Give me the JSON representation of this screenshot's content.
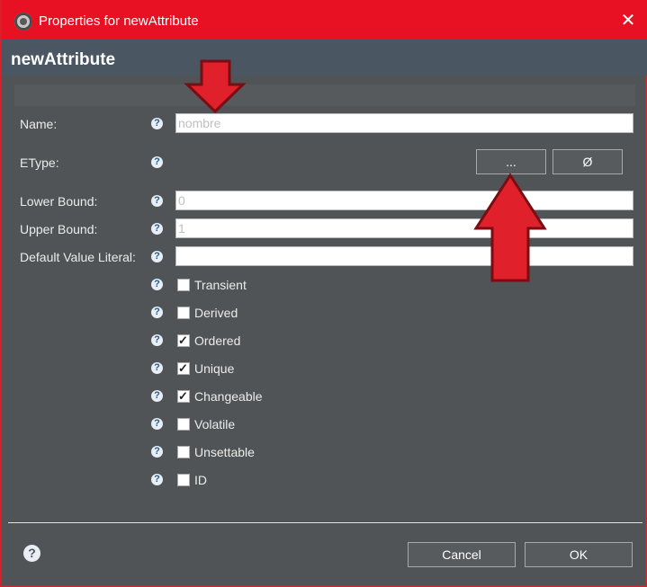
{
  "window": {
    "title": "Properties for newAttribute",
    "close_glyph": "✕"
  },
  "header": {
    "title": "newAttribute"
  },
  "fields": {
    "name": {
      "label": "Name:",
      "value": "nombre"
    },
    "etype": {
      "label": "EType:",
      "browse_label": "...",
      "clear_label": "Ø"
    },
    "lower_bound": {
      "label": "Lower Bound:",
      "value": "0"
    },
    "upper_bound": {
      "label": "Upper Bound:",
      "value": "1"
    },
    "default_value_literal": {
      "label": "Default Value Literal:",
      "value": ""
    }
  },
  "checkboxes": [
    {
      "label": "Transient",
      "checked": false
    },
    {
      "label": "Derived",
      "checked": false
    },
    {
      "label": "Ordered",
      "checked": true
    },
    {
      "label": "Unique",
      "checked": true
    },
    {
      "label": "Changeable",
      "checked": true
    },
    {
      "label": "Volatile",
      "checked": false
    },
    {
      "label": "Unsettable",
      "checked": false
    },
    {
      "label": "ID",
      "checked": false
    }
  ],
  "footer": {
    "cancel_label": "Cancel",
    "ok_label": "OK"
  },
  "icons": {
    "help": "help-icon",
    "app": "settings-gear-icon",
    "annotation": "red-arrow-annotation"
  },
  "colors": {
    "titlebar": "#e81123",
    "header": "#4a5662",
    "panel": "#505456",
    "annotation_red": "#e0202a"
  }
}
